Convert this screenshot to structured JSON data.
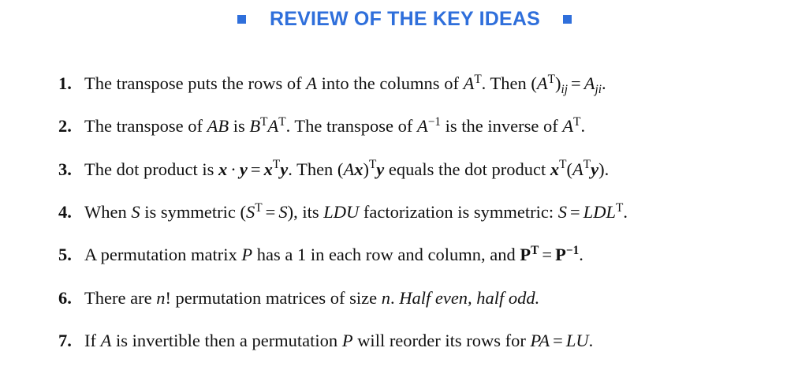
{
  "header": {
    "title": "REVIEW OF THE KEY IDEAS"
  },
  "items": [
    {
      "number": "1.",
      "text": "The transpose puts the rows of A into the columns of Aᵀ. Then (Aᵀ)ᵢⱼ = Aⱼᵢ."
    },
    {
      "number": "2.",
      "text": "The transpose of AB is BᵀAᵀ. The transpose of A⁻¹ is the inverse of Aᵀ."
    },
    {
      "number": "3.",
      "text": "The dot product is x · y = xᵀy. Then (Ax)ᵀy equals the dot product xᵀ(Aᵀy)."
    },
    {
      "number": "4.",
      "text": "When S is symmetric (Sᵀ = S), its LDU factorization is symmetric: S = LDLᵀ."
    },
    {
      "number": "5.",
      "text": "A permutation matrix P has a 1 in each row and column, and Pᵀ = P⁻¹."
    },
    {
      "number": "6.",
      "text": "There are n! permutation matrices of size n. Half even, half odd."
    },
    {
      "number": "7.",
      "text": "If A is invertible then a permutation P will reorder its rows for PA = LU."
    }
  ]
}
